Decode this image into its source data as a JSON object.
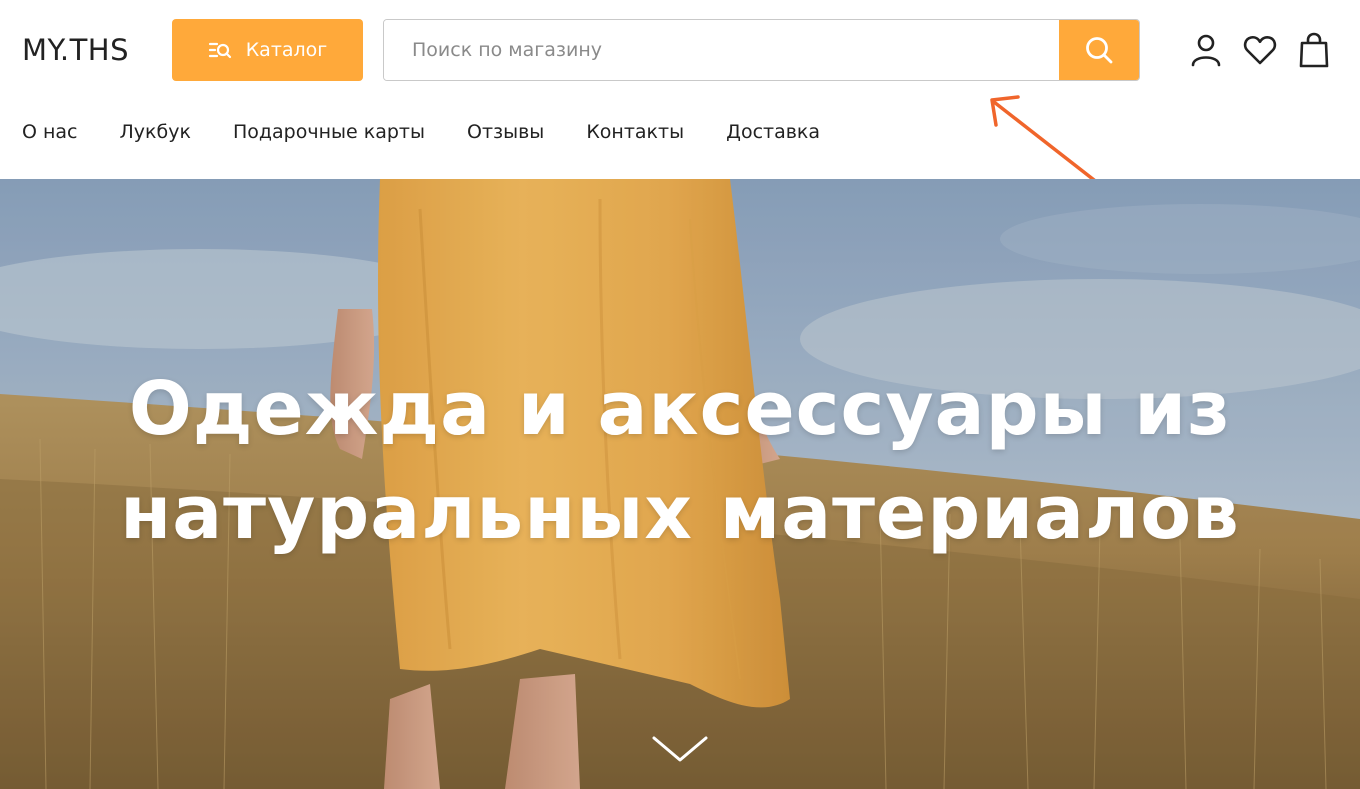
{
  "header": {
    "logo": "MY.THS",
    "catalog_label": "Каталог",
    "search_placeholder": "Поиск по магазину",
    "icons": [
      "user-icon",
      "heart-icon",
      "bag-icon"
    ]
  },
  "nav": {
    "items": [
      {
        "label": "О нас"
      },
      {
        "label": "Лукбук"
      },
      {
        "label": "Подарочные карты"
      },
      {
        "label": "Отзывы"
      },
      {
        "label": "Контакты"
      },
      {
        "label": "Доставка"
      }
    ]
  },
  "hero": {
    "title_line1": "Одежда и аксессуары из",
    "title_line2": "натуральных материалов"
  },
  "colors": {
    "accent": "#FFA93A",
    "annotation_arrow": "#F0652B"
  }
}
